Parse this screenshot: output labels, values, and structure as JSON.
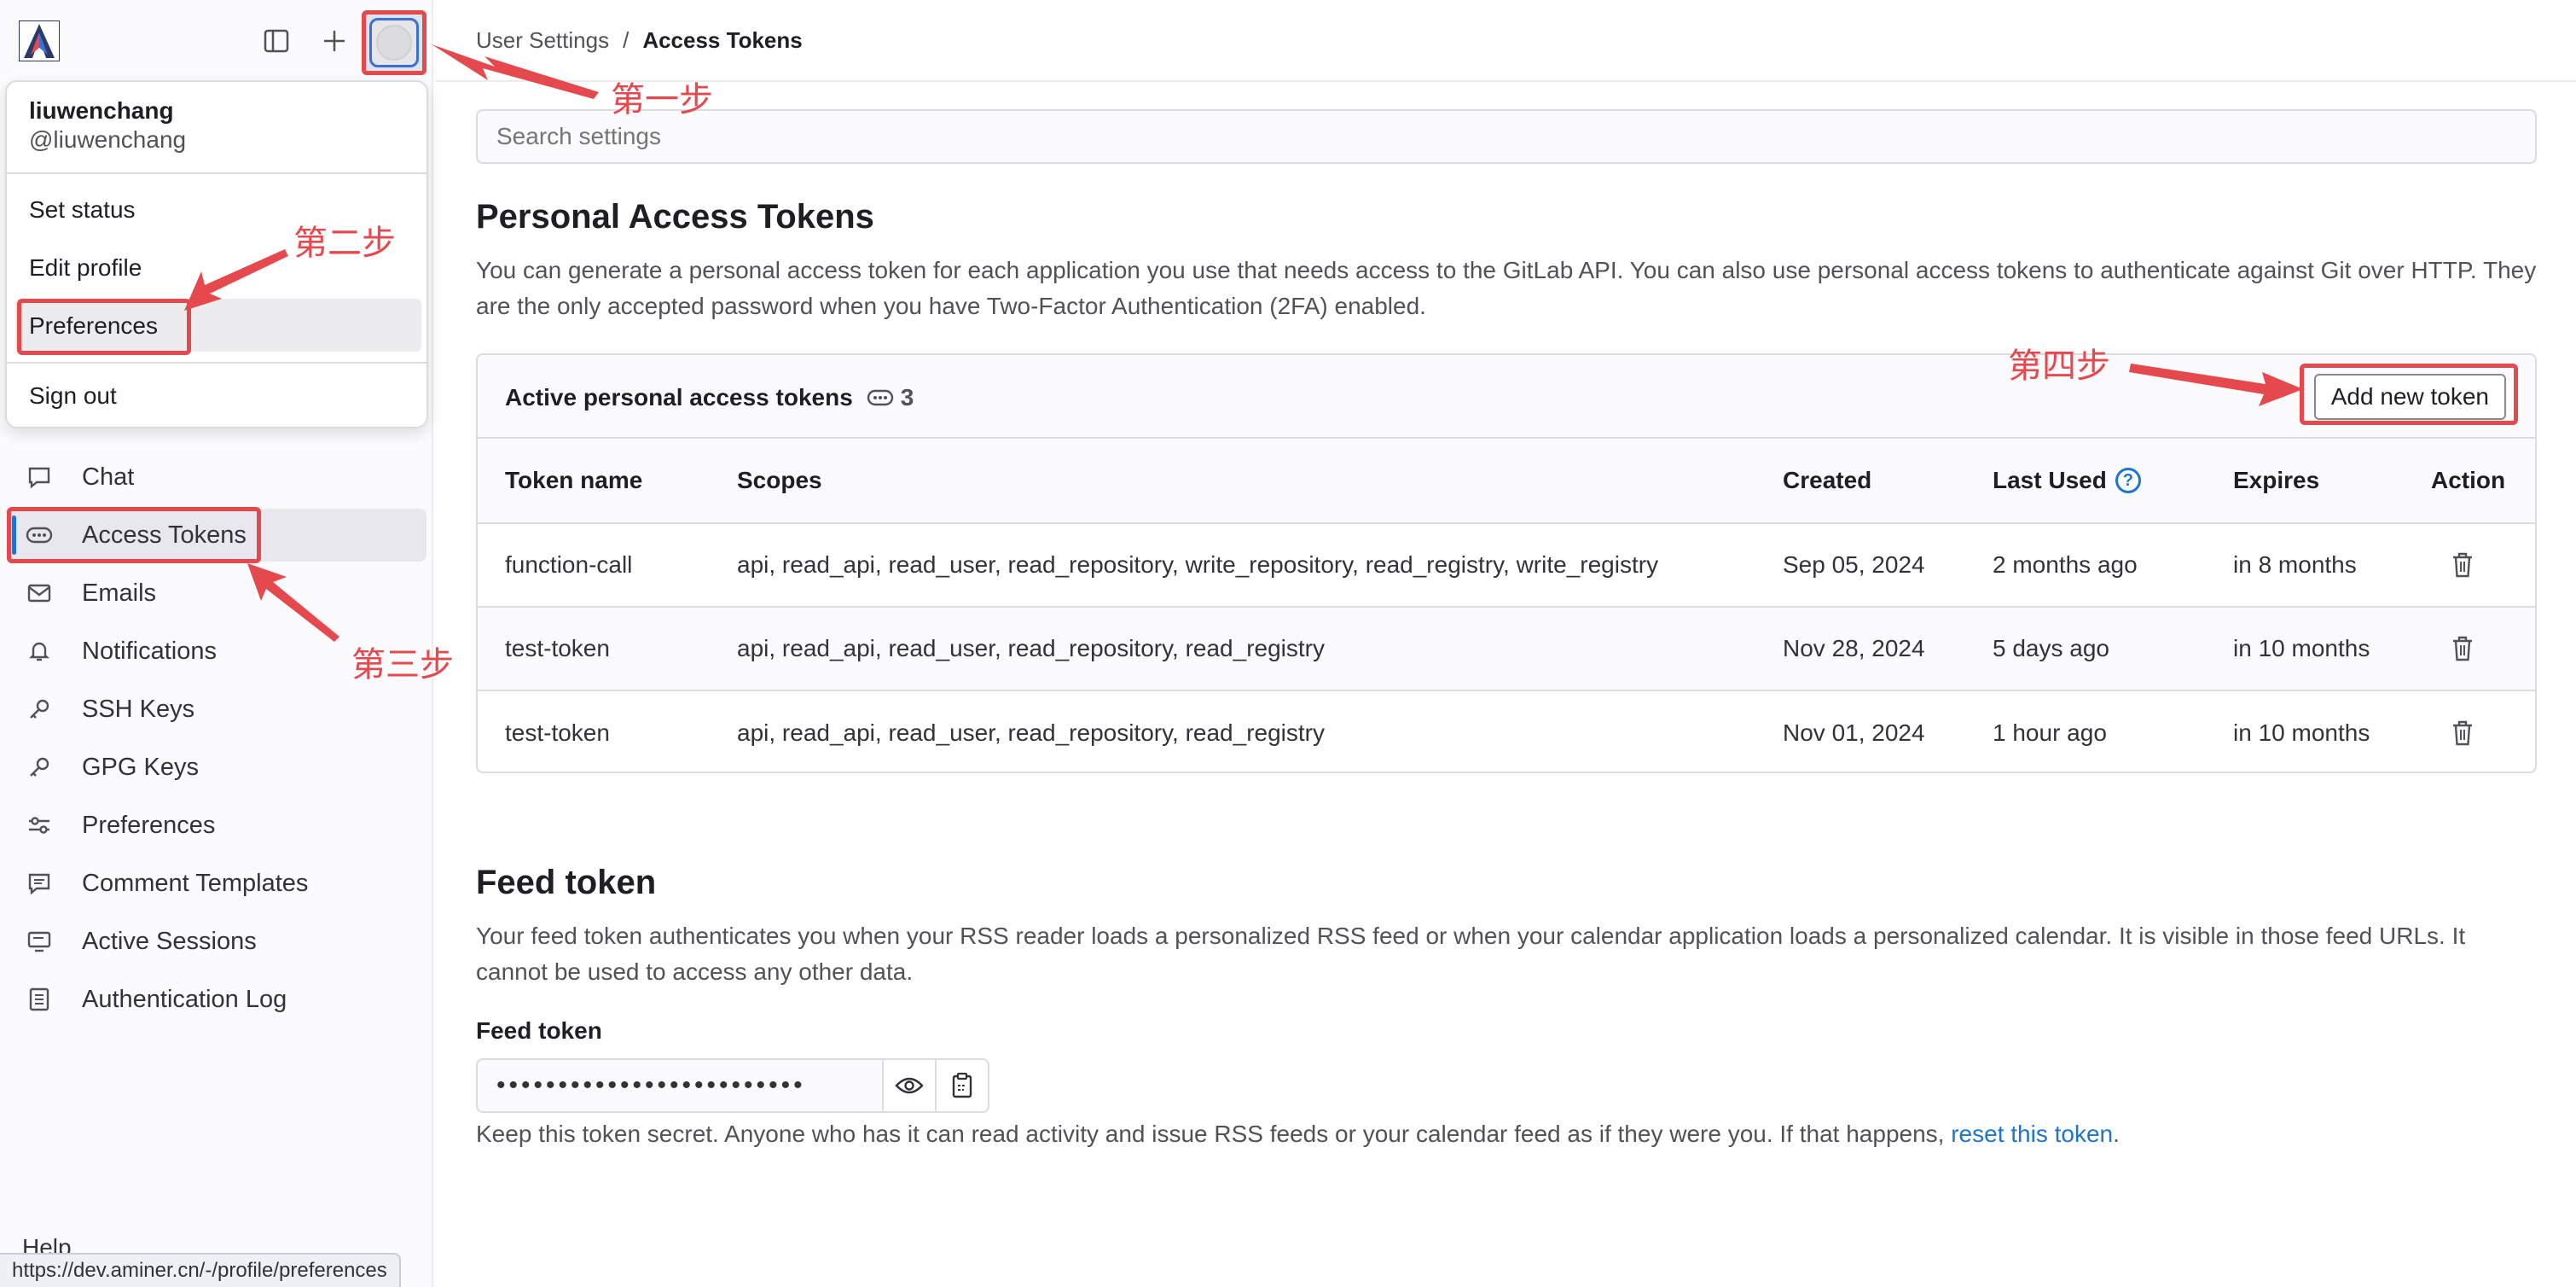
{
  "sidebar": {
    "nav_items": [
      {
        "label": "Chat",
        "icon": "chat-icon"
      },
      {
        "label": "Access Tokens",
        "icon": "token-icon",
        "active": true
      },
      {
        "label": "Emails",
        "icon": "mail-icon"
      },
      {
        "label": "Notifications",
        "icon": "bell-icon"
      },
      {
        "label": "SSH Keys",
        "icon": "key-icon"
      },
      {
        "label": "GPG Keys",
        "icon": "key-icon"
      },
      {
        "label": "Preferences",
        "icon": "preferences-icon"
      },
      {
        "label": "Comment Templates",
        "icon": "comment-icon"
      },
      {
        "label": "Active Sessions",
        "icon": "monitor-icon"
      },
      {
        "label": "Authentication Log",
        "icon": "log-icon"
      }
    ],
    "help_label": "Help",
    "status_url": "https://dev.aminer.cn/-/profile/preferences"
  },
  "user_menu": {
    "name": "liuwenchang",
    "handle": "@liuwenchang",
    "items": [
      "Set status",
      "Edit profile",
      "Preferences"
    ],
    "sign_out": "Sign out"
  },
  "breadcrumb": {
    "parent": "User Settings",
    "separator": "/",
    "current": "Access Tokens"
  },
  "search": {
    "placeholder": "Search settings"
  },
  "pat": {
    "title": "Personal Access Tokens",
    "description": "You can generate a personal access token for each application you use that needs access to the GitLab API. You can also use personal access tokens to authenticate against Git over HTTP. They are the only accepted password when you have Two-Factor Authentication (2FA) enabled.",
    "card_title": "Active personal access tokens",
    "count": "3",
    "add_button": "Add new token",
    "columns": [
      "Token name",
      "Scopes",
      "Created",
      "Last Used",
      "Expires",
      "Action"
    ],
    "rows": [
      {
        "name": "function-call",
        "scopes": "api, read_api, read_user, read_repository, write_repository, read_registry, write_registry",
        "created": "Sep 05, 2024",
        "last_used": "2 months ago",
        "expires": "in 8 months"
      },
      {
        "name": "test-token",
        "scopes": "api, read_api, read_user, read_repository, read_registry",
        "created": "Nov 28, 2024",
        "last_used": "5 days ago",
        "expires": "in 10 months"
      },
      {
        "name": "test-token",
        "scopes": "api, read_api, read_user, read_repository, read_registry",
        "created": "Nov 01, 2024",
        "last_used": "1 hour ago",
        "expires": "in 10 months"
      }
    ]
  },
  "feed": {
    "title": "Feed token",
    "description": "Your feed token authenticates you when your RSS reader loads a personalized RSS feed or when your calendar application loads a personalized calendar. It is visible in those feed URLs. It cannot be used to access any other data.",
    "label": "Feed token",
    "masked_value": "•••••••••••••••••••••••••",
    "hint_text": "Keep this token secret. Anyone who has it can read activity and issue RSS feeds or your calendar feed as if they were you. If that happens, ",
    "reset_link": "reset this token",
    "hint_end": "."
  },
  "annotations": {
    "step1": "第一步",
    "step2": "第二步",
    "step3": "第三步",
    "step4": "第四步"
  },
  "colors": {
    "annotation_red": "#e5484d",
    "link_blue": "#1f75cb",
    "active_indicator": "#1f75cb"
  }
}
